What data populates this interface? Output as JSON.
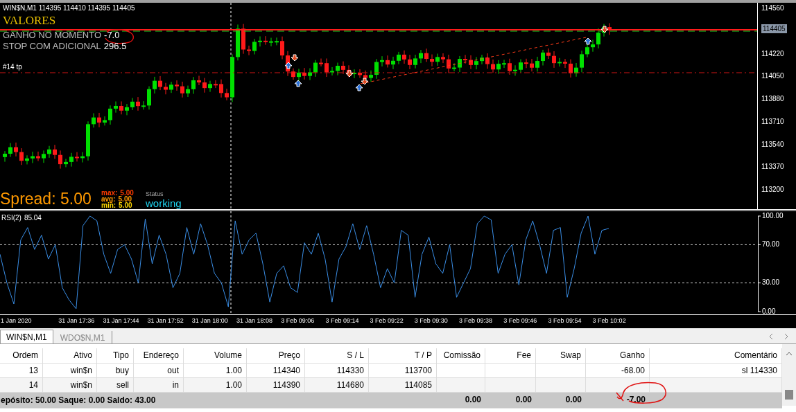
{
  "chart": {
    "symbol_line": "WIN$N,M1  114395 114410 114395 114405",
    "title": "VALORES",
    "gain_label": "GANHO NO MOMENTO",
    "gain_value": "-7.0",
    "stop_label": "STOP COM ADICIONAL",
    "stop_value": "296.5",
    "tp_label": "#14 tp",
    "spread": "Spread: 5.00",
    "spread_stats": [
      {
        "label": "max:",
        "value": "5.00",
        "color": "#ff3c00"
      },
      {
        "label": "avg:",
        "value": "5.00",
        "color": "#ff9900"
      },
      {
        "label": "min:",
        "value": "5.00",
        "color": "#ffd800"
      }
    ],
    "status_label": "Status",
    "status_value": "working",
    "price_axis": [
      "114560",
      "114220",
      "114050",
      "113880",
      "113710",
      "113540",
      "113370",
      "113200"
    ],
    "current_price_tag": "114405"
  },
  "rsi": {
    "value_label": "85.04",
    "chart_data": {
      "type": "line",
      "ylim": [
        0,
        100
      ],
      "yticks": [
        {
          "value": 100,
          "label": "100.00"
        },
        {
          "value": 70,
          "label": "70.00"
        },
        {
          "value": 30,
          "label": "30.00"
        },
        {
          "value": 0,
          "label": "0.00"
        }
      ],
      "series": [
        {
          "name": "RSI(2)",
          "color": "#3a8ee6",
          "values": [
            60,
            30,
            8,
            75,
            88,
            65,
            80,
            55,
            70,
            25,
            12,
            3,
            90,
            100,
            95,
            60,
            40,
            65,
            70,
            55,
            30,
            97,
            50,
            80,
            60,
            25,
            40,
            88,
            60,
            92,
            70,
            40,
            30,
            5,
            95,
            60,
            75,
            82,
            50,
            10,
            40,
            48,
            25,
            20,
            72,
            60,
            82,
            55,
            10,
            55,
            68,
            92,
            65,
            90,
            60,
            25,
            45,
            30,
            85,
            80,
            15,
            60,
            78,
            50,
            40,
            70,
            15,
            30,
            45,
            92,
            100,
            96,
            40,
            60,
            70,
            28,
            75,
            95,
            70,
            40,
            85,
            88,
            15,
            45,
            82,
            100,
            60,
            85,
            87
          ]
        }
      ]
    }
  },
  "time_axis": [
    "1 Jan 2020",
    "31 Jan 17:36",
    "31 Jan 17:44",
    "31 Jan 17:52",
    "31 Jan 18:00",
    "31 Jan 18:08",
    "3 Feb 09:06",
    "3 Feb 09:14",
    "3 Feb 09:22",
    "3 Feb 09:30",
    "3 Feb 09:38",
    "3 Feb 09:46",
    "3 Feb 09:54",
    "3 Feb 10:02"
  ],
  "tabs": [
    {
      "label": "WIN$N,M1",
      "selected": true
    },
    {
      "label": "WDO$N,M1",
      "selected": false
    }
  ],
  "table": {
    "columns": [
      "Ordem",
      "Ativo",
      "Tipo",
      "Endereço",
      "Volume",
      "Preço",
      "S / L",
      "T / P",
      "Comissão",
      "Fee",
      "Swap",
      "Ganho",
      "Comentário"
    ],
    "rows": [
      [
        "13",
        "win$n",
        "buy",
        "out",
        "1.00",
        "114340",
        "114330",
        "113700",
        "",
        "",
        "",
        "-68.00",
        "sl 114330"
      ],
      [
        "14",
        "win$n",
        "sell",
        "in",
        "1.00",
        "114390",
        "114680",
        "114085",
        "",
        "",
        "",
        "",
        ""
      ]
    ],
    "summary": {
      "text": "epósito: 50.00  Saque: 0.00  Saldo: 43.00",
      "cells": [
        "0.00",
        "0.00",
        "0.00",
        "-7.00"
      ]
    }
  }
}
